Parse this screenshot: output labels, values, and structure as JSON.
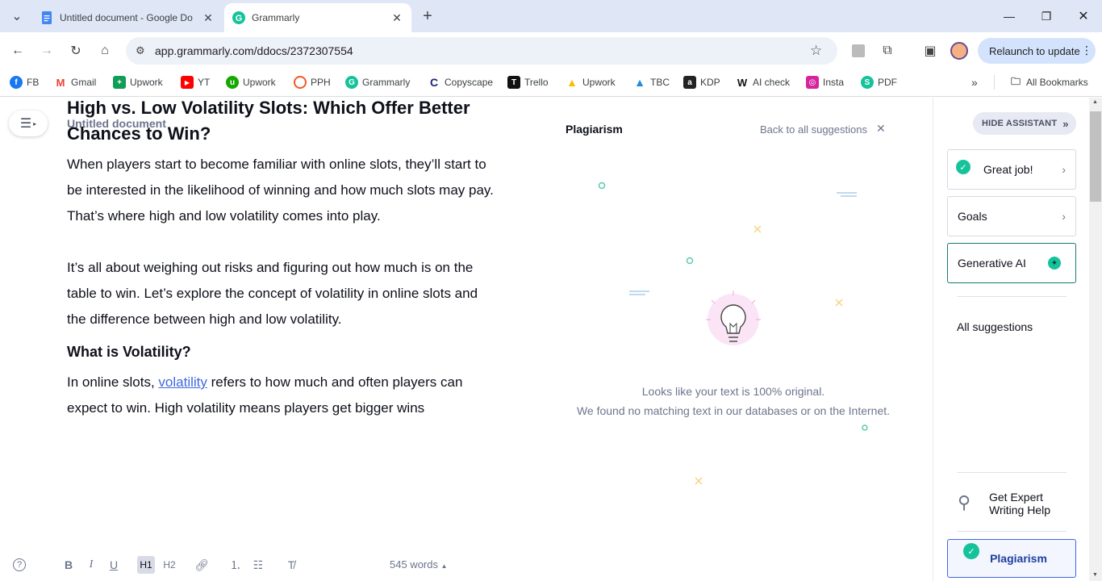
{
  "browser": {
    "tabs": [
      {
        "title": "Untitled document - Google Do",
        "active": false
      },
      {
        "title": "Grammarly",
        "active": true
      }
    ],
    "url": "app.grammarly.com/ddocs/2372307554",
    "relaunch_label": "Relaunch to update",
    "bookmarks": [
      {
        "label": "FB",
        "icon": "facebook-icon",
        "color": "#1877f2"
      },
      {
        "label": "Gmail",
        "icon": "gmail-icon",
        "color": "#ea4335"
      },
      {
        "label": "Upwork",
        "icon": "sheets-icon",
        "color": "#0f9d58"
      },
      {
        "label": "YT",
        "icon": "youtube-icon",
        "color": "#ff0000"
      },
      {
        "label": "Upwork",
        "icon": "upwork-icon",
        "color": "#14a800"
      },
      {
        "label": "PPH",
        "icon": "pph-icon",
        "color": "#f15a24"
      },
      {
        "label": "Grammarly",
        "icon": "grammarly-icon",
        "color": "#15c39a"
      },
      {
        "label": "Copyscape",
        "icon": "copyscape-icon",
        "color": "#1a237e"
      },
      {
        "label": "Trello",
        "icon": "trello-icon",
        "color": "#111111"
      },
      {
        "label": "Upwork",
        "icon": "drive-icon",
        "color": "#fbbc04"
      },
      {
        "label": "TBC",
        "icon": "tbc-icon",
        "color": "#1e88e5"
      },
      {
        "label": "KDP",
        "icon": "amazon-icon",
        "color": "#222222"
      },
      {
        "label": "AI check",
        "icon": "w-icon",
        "color": "#111111"
      },
      {
        "label": "Insta",
        "icon": "instagram-icon",
        "color": "#d6249f"
      },
      {
        "label": "PDF",
        "icon": "pdf-icon",
        "color": "#15c39a"
      }
    ],
    "all_bookmarks_label": "All Bookmarks"
  },
  "document": {
    "title": "Untitled document",
    "heading1": "High vs. Low Volatility Slots: Which Offer Better Chances to Win?",
    "para1": "When players start to become familiar with online slots, they’ll start to be interested in the likelihood of winning and how much slots may pay. That’s where high and low volatility comes into play.",
    "para2": "It’s all about weighing out risks and figuring out how much is on the table to win. Let’s explore the concept of volatility in online slots and the difference between high and low volatility.",
    "heading2": "What is Volatility?",
    "para3_before": "In online slots, ",
    "para3_link": "volatility",
    "para3_after": " refers to how much and often players can expect to win. High volatility means players get bigger wins",
    "word_count": "545 words"
  },
  "format_bar": {
    "bold": "B",
    "italic": "I",
    "underline": "U",
    "h1": "H1",
    "h2": "H2"
  },
  "plagiarism": {
    "title": "Plagiarism",
    "back_label": "Back to all suggestions",
    "message_line1": "Looks like your text is 100% original.",
    "message_line2": "We found no matching text in our databases or on the Internet."
  },
  "sidebar": {
    "hide_assistant": "HIDE ASSISTANT",
    "great_job": "Great job!",
    "goals": "Goals",
    "generative_ai": "Generative AI",
    "all_suggestions": "All suggestions",
    "expert_help": "Get Expert Writing Help",
    "plagiarism": "Plagiarism"
  }
}
